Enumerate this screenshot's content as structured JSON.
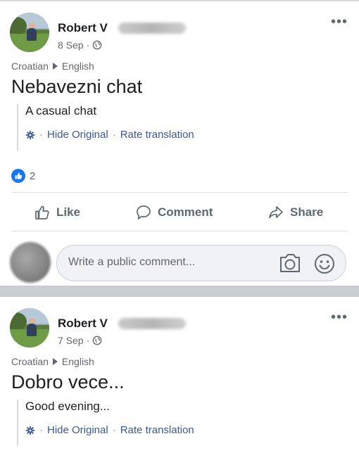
{
  "posts": [
    {
      "author": "Robert V",
      "date": "8 Sep",
      "more": "•••",
      "lang_from": "Croatian",
      "lang_to": "English",
      "original_text": "Nebavezni chat",
      "translated_text": "A casual chat",
      "hide_original": "Hide Original",
      "rate_translation": "Rate translation",
      "sep": "·",
      "like_count": "2",
      "actions": {
        "like": "Like",
        "comment": "Comment",
        "share": "Share"
      },
      "comment_placeholder": "Write a public comment..."
    },
    {
      "author": "Robert V",
      "date": "7 Sep",
      "more": "•••",
      "lang_from": "Croatian",
      "lang_to": "English",
      "original_text": "Dobro vece...",
      "translated_text": "Good evening...",
      "hide_original": "Hide Original",
      "rate_translation": "Rate translation",
      "sep": "·"
    }
  ],
  "icons": {
    "globe": "globe-icon",
    "gear": "gear-icon",
    "like": "thumbs-up-icon",
    "comment": "speech-bubble-icon",
    "share": "share-arrow-icon",
    "camera": "camera-icon",
    "smiley": "smiley-icon"
  },
  "colors": {
    "link": "#385898",
    "like_badge": "#1877f2",
    "muted": "#65676b",
    "separator": "#c9ccd1"
  }
}
